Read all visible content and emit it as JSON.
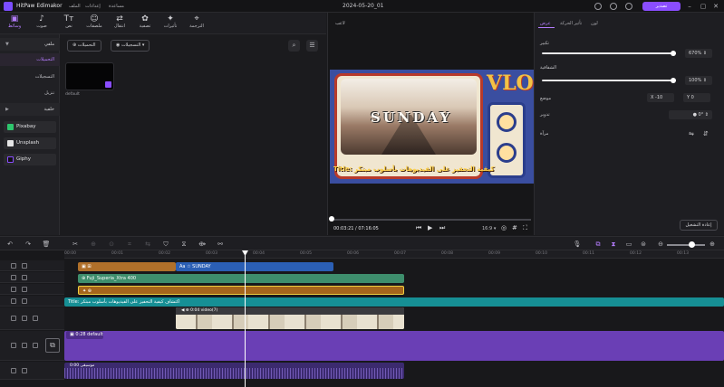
{
  "titlebar": {
    "app_name": "HitPaw Edimakor",
    "menus": [
      "الملف",
      "إعدادات",
      "مساعدة"
    ],
    "project_title": "2024-05-20_01",
    "export_label": "تصدير"
  },
  "toolbar": {
    "tools": [
      {
        "label": "وسائط",
        "icon": "▣"
      },
      {
        "label": "صوت",
        "icon": "♪"
      },
      {
        "label": "نص",
        "icon": "Tт"
      },
      {
        "label": "ملصقات",
        "icon": "☺"
      },
      {
        "label": "انتقال",
        "icon": "⇄"
      },
      {
        "label": "تصفية",
        "icon": "✿"
      },
      {
        "label": "تأثيرات",
        "icon": "✦"
      },
      {
        "label": "الترجمة",
        "icon": "⌖"
      }
    ]
  },
  "sidebar": {
    "section_local": "ملفي",
    "items": [
      "التحميلات",
      "التسجيلات",
      "تنزيل"
    ],
    "section_bg": "خلفية",
    "stock": [
      {
        "label": "Pixabay",
        "color": "#2ec66d"
      },
      {
        "label": "Unsplash",
        "color": "#e6e6e6"
      },
      {
        "label": "Giphy",
        "color": "#2a2a2e"
      }
    ]
  },
  "media": {
    "import_label": "التحميلات",
    "record_label": "التسجيلات",
    "thumb_label": "default"
  },
  "preview": {
    "title": "لاعب",
    "main_text": "SUNDAY",
    "vlog_text": "VLOG",
    "subtitle_text": "Title: كيفية التحفيز على الفيديوهات بأسلوب مبتكر",
    "time_current": "00:03:21",
    "time_total": "07:16:05",
    "zoom": "16:9",
    "progress": 0.01
  },
  "props": {
    "tabs": [
      "عرض",
      "تأثير الحركة",
      "لون"
    ],
    "scale_label": "تكبير",
    "scale_value": "670%",
    "opacity_label": "الشفافية",
    "opacity_value": "100%",
    "position_label": "موضع",
    "pos_x_label": "X",
    "pos_x_value": "-10",
    "pos_y_label": "Y",
    "pos_y_value": "0",
    "rotate_label": "تدوير",
    "rotate_value": "0°",
    "mirror_label": "مرآة",
    "reset_label": "إعادة التشغيل"
  },
  "timeline": {
    "ticks": [
      "00:00",
      "00:01",
      "00:02",
      "00:03",
      "00:04",
      "00:05",
      "00:06",
      "00:07",
      "00:08",
      "00:09",
      "00:10",
      "00:11",
      "00:12",
      "00:13",
      "00:14"
    ],
    "clips": {
      "text1": "SUNDAY",
      "filter": "Fuji_Superia_Xtra 400",
      "title": "Title: اكتشاف كيفية التحفيز على الفيديوهات بأسلوب مبتكر",
      "video": "0:04 video(7)",
      "bg": "0:28 default",
      "audio": "0:00 موسيقى"
    }
  }
}
